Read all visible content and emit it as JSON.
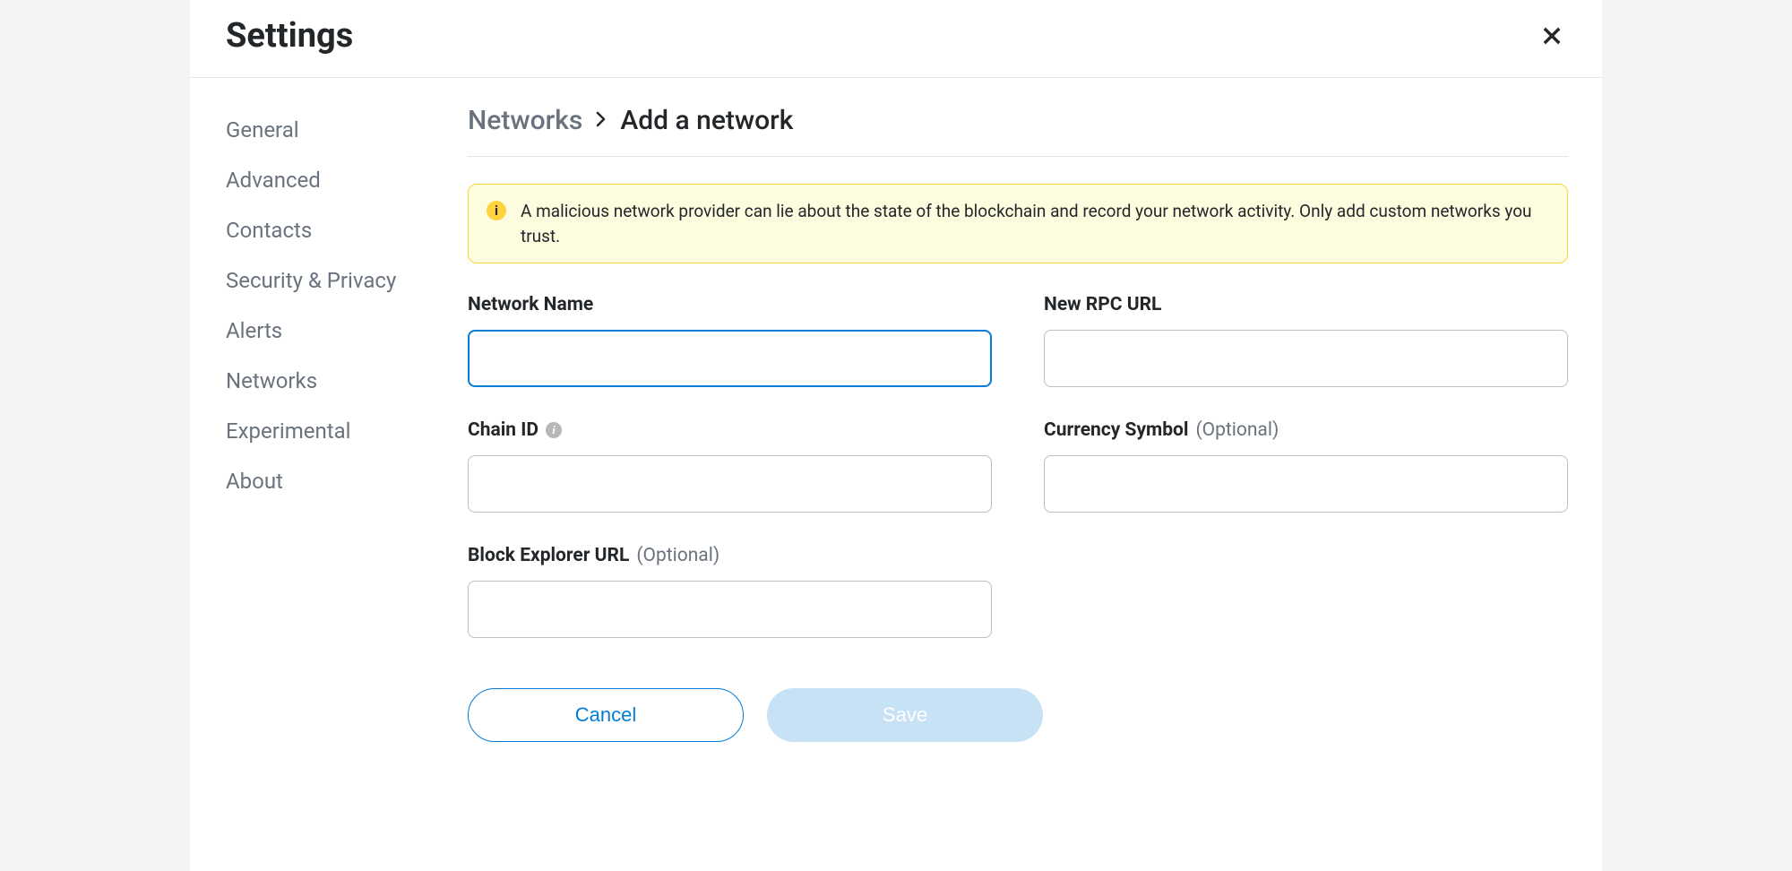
{
  "modal": {
    "title": "Settings"
  },
  "sidebar": {
    "items": [
      {
        "label": "General"
      },
      {
        "label": "Advanced"
      },
      {
        "label": "Contacts"
      },
      {
        "label": "Security & Privacy"
      },
      {
        "label": "Alerts"
      },
      {
        "label": "Networks"
      },
      {
        "label": "Experimental"
      },
      {
        "label": "About"
      }
    ]
  },
  "breadcrumb": {
    "parent": "Networks",
    "current": "Add a network"
  },
  "warning": {
    "text": "A malicious network provider can lie about the state of the blockchain and record your network activity. Only add custom networks you trust."
  },
  "fields": {
    "network_name": {
      "label": "Network Name",
      "value": ""
    },
    "rpc_url": {
      "label": "New RPC URL",
      "value": ""
    },
    "chain_id": {
      "label": "Chain ID",
      "value": ""
    },
    "currency_symbol": {
      "label": "Currency Symbol",
      "optional": "(Optional)",
      "value": ""
    },
    "block_explorer": {
      "label": "Block Explorer URL",
      "optional": "(Optional)",
      "value": ""
    }
  },
  "buttons": {
    "cancel": "Cancel",
    "save": "Save"
  }
}
